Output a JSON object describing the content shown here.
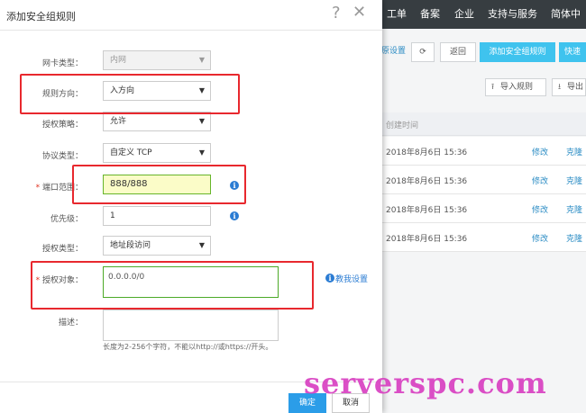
{
  "topnav": {
    "items": [
      "工单",
      "备案",
      "企业",
      "支持与服务",
      "简体中文"
    ]
  },
  "background": {
    "toolbar": {
      "restore_label": "还原设置",
      "back_label": "返回",
      "add_rule_label": "添加安全组规则",
      "quick_label": "快速"
    },
    "import_label": "导入规则",
    "export_label": "导出",
    "table": {
      "column_created": "创建时间",
      "rows": [
        {
          "time": "2018年8月6日 15:36",
          "edit": "修改",
          "clone": "克隆"
        },
        {
          "time": "2018年8月6日 15:36",
          "edit": "修改",
          "clone": "克隆"
        },
        {
          "time": "2018年8月6日 15:36",
          "edit": "修改",
          "clone": "克隆"
        },
        {
          "time": "2018年8月6日 15:36",
          "edit": "修改",
          "clone": "克隆"
        }
      ]
    }
  },
  "dialog": {
    "title": "添加安全组规则",
    "nic_type": {
      "label": "网卡类型：",
      "value": "内网"
    },
    "direction": {
      "label": "规则方向：",
      "value": "入方向"
    },
    "policy": {
      "label": "授权策略：",
      "value": "允许"
    },
    "protocol": {
      "label": "协议类型：",
      "value": "自定义 TCP"
    },
    "port_range": {
      "label": "端口范围：",
      "value": "888/888"
    },
    "priority": {
      "label": "优先级：",
      "value": "1"
    },
    "auth_type": {
      "label": "授权类型：",
      "value": "地址段访问"
    },
    "auth_object": {
      "label": "授权对象：",
      "value": "0.0.0.0/0",
      "help_link": "教我设置"
    },
    "description": {
      "label": "描述：",
      "value": "",
      "hint": "长度为2-256个字符，不能以http://或https://开头。"
    },
    "confirm_label": "确定",
    "cancel_label": "取消"
  },
  "watermark": "serverspc.com",
  "colors": {
    "highlight": "#e8282e",
    "primary": "#2b9de8",
    "nav_bg": "#373d41"
  }
}
